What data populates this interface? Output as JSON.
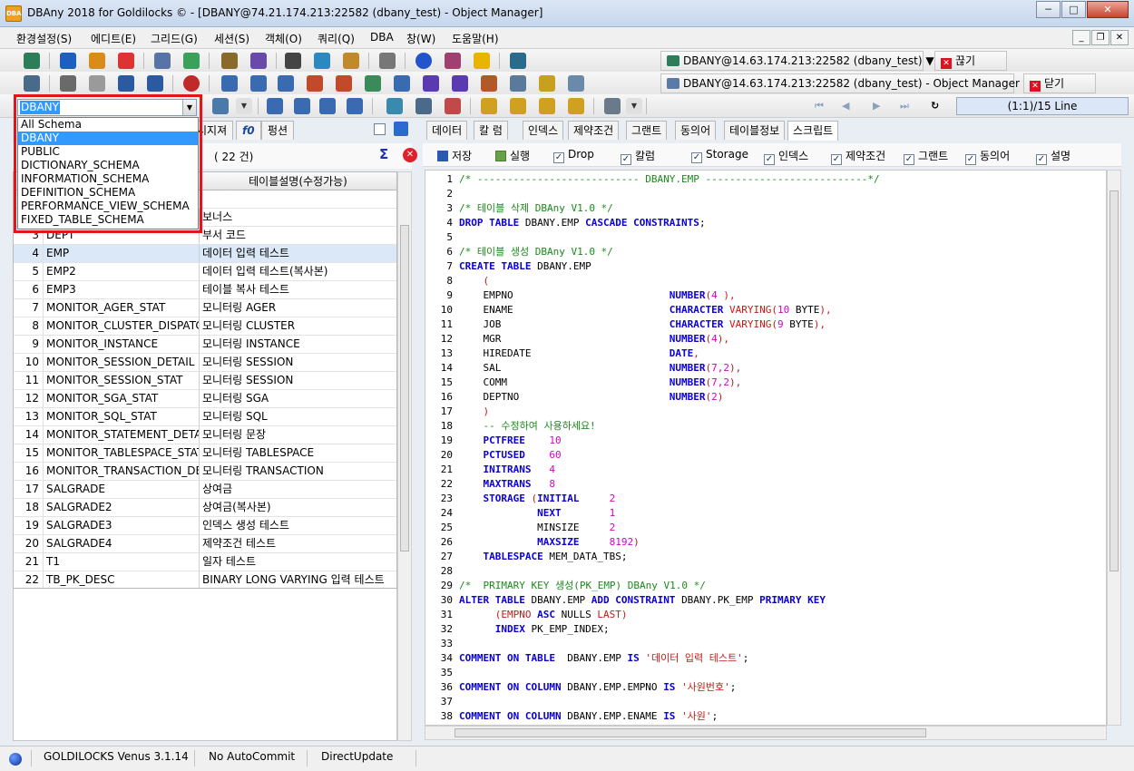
{
  "window": {
    "title": "DBAny 2018 for Goldilocks © - [DBANY@74.21.174.213:22582 (dbany_test) - Object Manager]",
    "app_icon_text": "DBA",
    "minimize": "─",
    "maximize": "□",
    "close": "✕"
  },
  "menu": {
    "items": [
      "환경설정(S)",
      "에디트(E)",
      "그리드(G)",
      "세션(S)",
      "객체(O)",
      "쿼리(Q)",
      "DBA",
      "창(W)",
      "도움말(H)"
    ],
    "mdi_minimize": "_",
    "mdi_restore": "❐",
    "mdi_close": "✕"
  },
  "connections": {
    "top": {
      "label": "DBANY@14.63.174.213:22582 (dbany_test) ▼",
      "action": "끊기"
    },
    "second": {
      "label": "DBANY@14.63.174.213:22582 (dbany_test) - Object Manager ▼",
      "action": "닫기"
    }
  },
  "nav": {
    "first": "⏮",
    "prev": "◀",
    "next": "▶",
    "last": "⏭",
    "refresh": "↻",
    "line_info": "(1:1)/15 Line"
  },
  "schema": {
    "selected": "DBANY",
    "arrow": "▼",
    "options": [
      "All Schema",
      "DBANY",
      "PUBLIC",
      "DICTIONARY_SCHEMA",
      "INFORMATION_SCHEMA",
      "DEFINITION_SCHEMA",
      "PERFORMANCE_VIEW_SCHEMA",
      "FIXED_TABLE_SCHEMA"
    ],
    "selected_index": 1
  },
  "left_tabs": [
    "시지져",
    "f0",
    "펑션"
  ],
  "left_count": "( 22 건)",
  "sigma": "Σ",
  "cancel": "✕",
  "table_grid": {
    "header_desc": "테이블설명(수정가능)",
    "selected_row": 3,
    "rows": [
      {
        "num": "1",
        "name": "",
        "desc": ""
      },
      {
        "num": "2",
        "name": "",
        "desc": "보너스"
      },
      {
        "num": "3",
        "name": "DEPT",
        "desc": "부서 코드"
      },
      {
        "num": "4",
        "name": "EMP",
        "desc": "데이터 입력 테스트"
      },
      {
        "num": "5",
        "name": "EMP2",
        "desc": "데이터 입력 테스트(복사본)"
      },
      {
        "num": "6",
        "name": "EMP3",
        "desc": "테이블 복사 테스트"
      },
      {
        "num": "7",
        "name": "MONITOR_AGER_STAT",
        "desc": "모니터링 AGER"
      },
      {
        "num": "8",
        "name": "MONITOR_CLUSTER_DISPATCH",
        "desc": "모니터링 CLUSTER"
      },
      {
        "num": "9",
        "name": "MONITOR_INSTANCE",
        "desc": "모니터링 INSTANCE"
      },
      {
        "num": "10",
        "name": "MONITOR_SESSION_DETAIL",
        "desc": "모니터링 SESSION"
      },
      {
        "num": "11",
        "name": "MONITOR_SESSION_STAT",
        "desc": "모니터링 SESSION"
      },
      {
        "num": "12",
        "name": "MONITOR_SGA_STAT",
        "desc": "모니터링 SGA"
      },
      {
        "num": "13",
        "name": "MONITOR_SQL_STAT",
        "desc": "모니터링 SQL"
      },
      {
        "num": "14",
        "name": "MONITOR_STATEMENT_DETAIL",
        "desc": "모니터링 문장"
      },
      {
        "num": "15",
        "name": "MONITOR_TABLESPACE_STAT",
        "desc": "모니터링 TABLESPACE"
      },
      {
        "num": "16",
        "name": "MONITOR_TRANSACTION_DETAIL",
        "desc": "모니터링 TRANSACTION"
      },
      {
        "num": "17",
        "name": "SALGRADE",
        "desc": "상여금"
      },
      {
        "num": "18",
        "name": "SALGRADE2",
        "desc": "상여금(복사본)"
      },
      {
        "num": "19",
        "name": "SALGRADE3",
        "desc": "인덱스 생성 테스트"
      },
      {
        "num": "20",
        "name": "SALGRADE4",
        "desc": "제약조건 테스트"
      },
      {
        "num": "21",
        "name": "T1",
        "desc": "일자 테스트"
      },
      {
        "num": "22",
        "name": "TB_PK_DESC",
        "desc": "BINARY LONG VARYING 입력 테스트"
      }
    ]
  },
  "right_tabs": [
    "데이터",
    "칼 럼",
    "인덱스",
    "제약조건",
    "그랜트",
    "동의어",
    "테이블정보",
    "스크립트"
  ],
  "active_right_tab": 7,
  "script_toolbar": {
    "save": "저장",
    "run": "실행",
    "options": [
      "Drop",
      "칼럼",
      "Storage",
      "인덱스",
      "제약조건",
      "그랜트",
      "동의어",
      "설명"
    ]
  },
  "script_lines": [
    [
      [
        "c-com",
        "/* --------------------------- DBANY.EMP ---------------------------*/"
      ]
    ],
    [],
    [
      [
        "c-com",
        "/* 테이블 삭제 DBAny V1.0 */"
      ]
    ],
    [
      [
        "c-kw",
        "DROP TABLE "
      ],
      [
        "c-id",
        "DBANY.EMP "
      ],
      [
        "c-kw",
        "CASCADE CONSTRAINTS"
      ],
      [
        "c-id",
        ";"
      ]
    ],
    [],
    [
      [
        "c-com",
        "/* 테이블 생성 DBAny V1.0 */"
      ]
    ],
    [
      [
        "c-kw",
        "CREATE TABLE "
      ],
      [
        "c-id",
        "DBANY.EMP"
      ]
    ],
    [
      [
        "c-str",
        "    ("
      ]
    ],
    [
      [
        "c-id",
        "    EMPNO                          "
      ],
      [
        "c-kw",
        "NUMBER"
      ],
      [
        "c-str",
        "("
      ],
      [
        "c-num",
        "4"
      ],
      [
        "c-str",
        " ),"
      ]
    ],
    [
      [
        "c-id",
        "    ENAME                          "
      ],
      [
        "c-kw",
        "CHARACTER "
      ],
      [
        "c-str",
        "VARYING("
      ],
      [
        "c-num",
        "10"
      ],
      [
        "c-id",
        " BYTE"
      ],
      [
        "c-str",
        "),"
      ]
    ],
    [
      [
        "c-id",
        "    JOB                            "
      ],
      [
        "c-kw",
        "CHARACTER "
      ],
      [
        "c-str",
        "VARYING("
      ],
      [
        "c-num",
        "9"
      ],
      [
        "c-id",
        " BYTE"
      ],
      [
        "c-str",
        "),"
      ]
    ],
    [
      [
        "c-id",
        "    MGR                            "
      ],
      [
        "c-kw",
        "NUMBER"
      ],
      [
        "c-str",
        "("
      ],
      [
        "c-num",
        "4"
      ],
      [
        "c-str",
        "),"
      ]
    ],
    [
      [
        "c-id",
        "    HIREDATE                       "
      ],
      [
        "c-kw",
        "DATE"
      ],
      [
        "c-str",
        ","
      ]
    ],
    [
      [
        "c-id",
        "    SAL                            "
      ],
      [
        "c-kw",
        "NUMBER"
      ],
      [
        "c-str",
        "("
      ],
      [
        "c-num",
        "7,2"
      ],
      [
        "c-str",
        "),"
      ]
    ],
    [
      [
        "c-id",
        "    COMM                           "
      ],
      [
        "c-kw",
        "NUMBER"
      ],
      [
        "c-str",
        "("
      ],
      [
        "c-num",
        "7,2"
      ],
      [
        "c-str",
        "),"
      ]
    ],
    [
      [
        "c-id",
        "    DEPTNO                         "
      ],
      [
        "c-kw",
        "NUMBER"
      ],
      [
        "c-str",
        "("
      ],
      [
        "c-num",
        "2"
      ],
      [
        "c-str",
        ")"
      ]
    ],
    [
      [
        "c-str",
        "    )"
      ]
    ],
    [
      [
        "c-com",
        "    -- 수정하여 사용하세요!"
      ]
    ],
    [
      [
        "c-kw",
        "    PCTFREE    "
      ],
      [
        "c-num",
        "10"
      ]
    ],
    [
      [
        "c-kw",
        "    PCTUSED    "
      ],
      [
        "c-num",
        "60"
      ]
    ],
    [
      [
        "c-kw",
        "    INITRANS   "
      ],
      [
        "c-num",
        "4"
      ]
    ],
    [
      [
        "c-kw",
        "    MAXTRANS   "
      ],
      [
        "c-num",
        "8"
      ]
    ],
    [
      [
        "c-kw",
        "    STORAGE "
      ],
      [
        "c-str",
        "("
      ],
      [
        "c-kw",
        "INITIAL     "
      ],
      [
        "c-num",
        "2"
      ]
    ],
    [
      [
        "c-kw",
        "             NEXT        "
      ],
      [
        "c-num",
        "1"
      ]
    ],
    [
      [
        "c-id",
        "             MINSIZE     "
      ],
      [
        "c-num",
        "2"
      ]
    ],
    [
      [
        "c-kw",
        "             MAXSIZE     "
      ],
      [
        "c-num",
        "8192"
      ],
      [
        "c-str",
        ")"
      ]
    ],
    [
      [
        "c-kw",
        "    TABLESPACE "
      ],
      [
        "c-id",
        "MEM_DATA_TBS;"
      ]
    ],
    [],
    [
      [
        "c-com",
        "/*  PRIMARY KEY 생성(PK_EMP) DBAny V1.0 */"
      ]
    ],
    [
      [
        "c-kw",
        "ALTER TABLE "
      ],
      [
        "c-id",
        "DBANY.EMP "
      ],
      [
        "c-kw",
        "ADD CONSTRAINT "
      ],
      [
        "c-id",
        "DBANY.PK_EMP "
      ],
      [
        "c-kw",
        "PRIMARY KEY"
      ]
    ],
    [
      [
        "c-str",
        "      (EMPNO "
      ],
      [
        "c-kw",
        "ASC "
      ],
      [
        "c-id",
        "NULLS "
      ],
      [
        "c-str",
        "LAST)"
      ]
    ],
    [
      [
        "c-kw",
        "      INDEX "
      ],
      [
        "c-id",
        "PK_EMP_INDEX;"
      ]
    ],
    [],
    [
      [
        "c-kw",
        "COMMENT ON TABLE  "
      ],
      [
        "c-id",
        "DBANY.EMP "
      ],
      [
        "c-kw",
        "IS "
      ],
      [
        "c-str",
        "'데이터 입력 테스트'"
      ],
      [
        "c-id",
        ";"
      ]
    ],
    [],
    [
      [
        "c-kw",
        "COMMENT ON COLUMN "
      ],
      [
        "c-id",
        "DBANY.EMP.EMPNO "
      ],
      [
        "c-kw",
        "IS "
      ],
      [
        "c-str",
        "'사원번호'"
      ],
      [
        "c-id",
        ";"
      ]
    ],
    [],
    [
      [
        "c-kw",
        "COMMENT ON COLUMN "
      ],
      [
        "c-id",
        "DBANY.EMP.ENAME "
      ],
      [
        "c-kw",
        "IS "
      ],
      [
        "c-str",
        "'사원'"
      ],
      [
        "c-id",
        ";"
      ]
    ]
  ],
  "status": {
    "db": "GOLDILOCKS Venus 3.1.14",
    "commit": "No AutoCommit",
    "update": "DirectUpdate"
  }
}
